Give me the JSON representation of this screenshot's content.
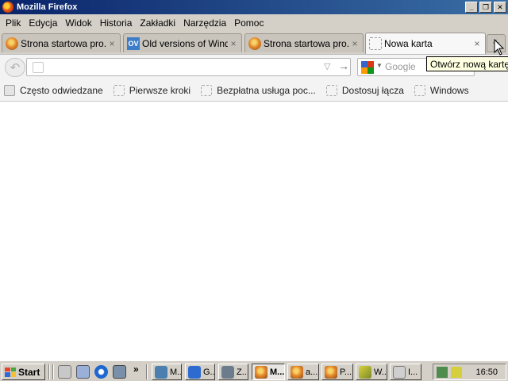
{
  "window": {
    "title": "Mozilla Firefox",
    "buttons": [
      "minimize-icon",
      "restore-icon",
      "close-icon"
    ]
  },
  "menu": [
    "Plik",
    "Edycja",
    "Widok",
    "Historia",
    "Zakładki",
    "Narzędzia",
    "Pomoc"
  ],
  "tabs": [
    {
      "label": "Strona startowa pro...",
      "icon": "firefox-icon",
      "close": "×"
    },
    {
      "label": "Old versions of Wind...",
      "icon": "oldversion-icon",
      "icon_text": "OV",
      "close": "×"
    },
    {
      "label": "Strona startowa pro...",
      "icon": "firefox-icon",
      "close": "×"
    },
    {
      "label": "Nowa karta",
      "icon": "blank-page-icon",
      "close": "×",
      "active": true
    }
  ],
  "new_tab_button": "+",
  "tooltip": "Otwórz nową kartę",
  "navbar": {
    "back_glyph": "↶",
    "url_value": "",
    "dropmarker_glyph": "▽",
    "go_glyph": "→",
    "search_placeholder": "Google",
    "search_arrow_glyph": "▼"
  },
  "bookmarks": [
    "Często odwiedzane",
    "Pierwsze kroki",
    "Bezpłatna usługa poc...",
    "Dostosuj łącza",
    "Windows"
  ],
  "taskbar": {
    "start_label": "Start",
    "chevron": "»",
    "tasks": [
      {
        "label": "M...",
        "icon": "monitor-icon"
      },
      {
        "label": "G...",
        "icon": "ie-page-icon"
      },
      {
        "label": "Z...",
        "icon": "computer-icon"
      },
      {
        "label": "M...",
        "icon": "firefox-icon",
        "pressed": true
      },
      {
        "label": "a...",
        "icon": "firefox-icon"
      },
      {
        "label": "P...",
        "icon": "firefox-icon"
      },
      {
        "label": "W...",
        "icon": "winamp-icon"
      },
      {
        "label": "I...",
        "icon": "installer-icon"
      }
    ],
    "clock": "16:50"
  },
  "colors": {
    "titlebar_start": "#0a246a",
    "titlebar_end": "#3a6ea5",
    "chrome": "#d4d0c8",
    "tooltip_bg": "#ffffe1"
  }
}
